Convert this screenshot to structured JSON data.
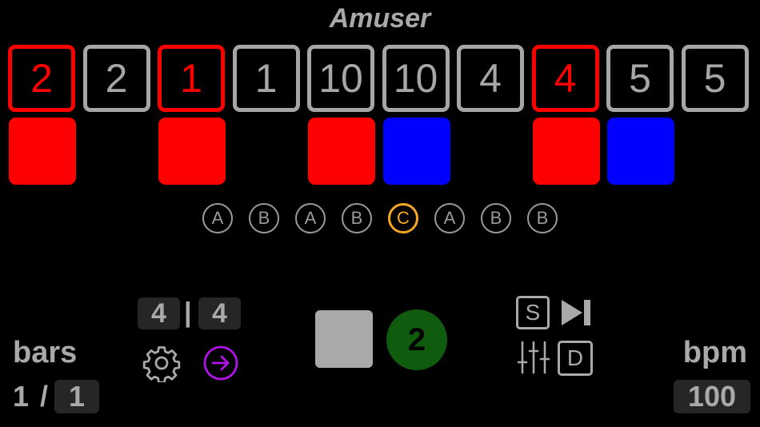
{
  "app": {
    "title": "Amuser"
  },
  "steps": [
    {
      "value": "2",
      "active": true
    },
    {
      "value": "2",
      "active": false
    },
    {
      "value": "1",
      "active": true
    },
    {
      "value": "1",
      "active": false
    },
    {
      "value": "10",
      "active": false
    },
    {
      "value": "10",
      "active": false
    },
    {
      "value": "4",
      "active": false
    },
    {
      "value": "4",
      "active": true
    },
    {
      "value": "5",
      "active": false
    },
    {
      "value": "5",
      "active": false
    }
  ],
  "pads": [
    {
      "color": "#ff0000"
    },
    {
      "color": null
    },
    {
      "color": "#ff0000"
    },
    {
      "color": null
    },
    {
      "color": "#ff0000"
    },
    {
      "color": "#0000ff"
    },
    {
      "color": null
    },
    {
      "color": "#ff0000"
    },
    {
      "color": "#0000ff"
    },
    {
      "color": null
    }
  ],
  "sections": [
    {
      "label": "A",
      "current": false
    },
    {
      "label": "B",
      "current": false
    },
    {
      "label": "A",
      "current": false
    },
    {
      "label": "B",
      "current": false
    },
    {
      "label": "C",
      "current": true
    },
    {
      "label": "A",
      "current": false
    },
    {
      "label": "B",
      "current": false
    },
    {
      "label": "B",
      "current": false
    }
  ],
  "bars": {
    "label": "bars",
    "current": "1",
    "separator": "/",
    "total": "1"
  },
  "time_signature": {
    "numerator": "4",
    "separator": "|",
    "denominator": "4"
  },
  "icons": {
    "settings": "gear-icon",
    "next": "arrow-right-circle-icon",
    "skip": "skip-forward-icon",
    "mixer": "mixer-sliders-icon"
  },
  "transport": {
    "count": "2"
  },
  "buttons": {
    "s_label": "S",
    "d_label": "D"
  },
  "bpm": {
    "label": "bpm",
    "value": "100"
  },
  "colors": {
    "active": "#ff0000",
    "inactive": "#a6a6a6",
    "pad_red": "#ff0000",
    "pad_blue": "#0000ff",
    "section_current": "#f5a623",
    "next_arrow": "#b012e8",
    "count_badge": "#0f5c0f"
  }
}
